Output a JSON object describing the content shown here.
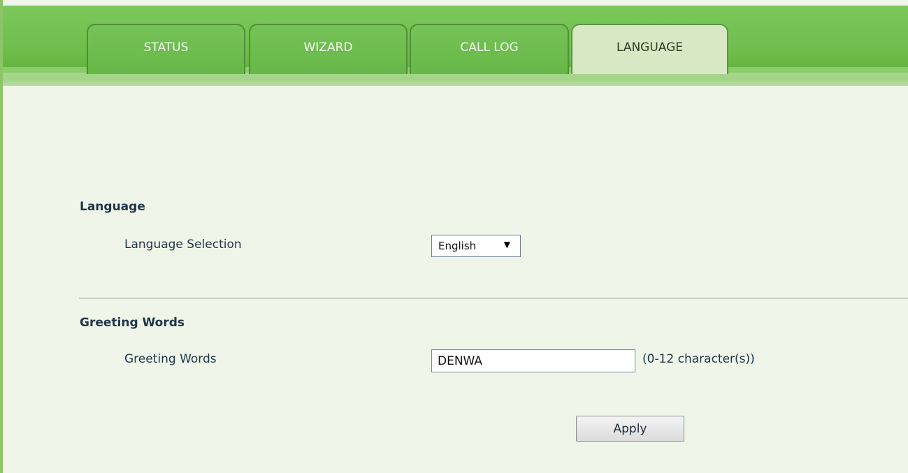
{
  "nav": {
    "tabs": [
      {
        "label": "STATUS",
        "active": false
      },
      {
        "label": "WIZARD",
        "active": false
      },
      {
        "label": "CALL LOG",
        "active": false
      },
      {
        "label": "LANGUAGE",
        "active": true
      }
    ]
  },
  "language_section": {
    "title": "Language",
    "selection_label": "Language Selection",
    "selected_value": "English"
  },
  "greeting_section": {
    "title": "Greeting Words",
    "field_label": "Greeting Words",
    "field_value": "DENWA",
    "hint": "(0-12 character(s))"
  },
  "actions": {
    "apply_label": "Apply"
  },
  "colors": {
    "header_green": "#6ebd4c",
    "active_tab": "#d8e8c4",
    "page_background": "#eff5e9",
    "label_text": "#1f3548"
  },
  "icons": {
    "select_arrow": "triangle-down-icon"
  }
}
